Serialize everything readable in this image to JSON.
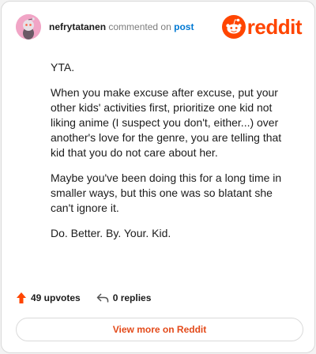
{
  "comment": {
    "username": "nefrytatanen",
    "action_text": "commented on",
    "post_link": "post",
    "paragraphs": [
      "YTA.",
      "When you make excuse after excuse, put your other kids' activities first, prioritize one kid not liking anime (I suspect you don't, either...) over another's love for the genre, you are telling that kid that you do not care about her.",
      "Maybe you've been doing this for a long time in smaller ways, but this one was so blatant she can't ignore it.",
      "Do. Better. By. Your. Kid."
    ]
  },
  "brand": {
    "logo_text": "reddit",
    "accent": "#ff4500"
  },
  "footer": {
    "upvotes": "49 upvotes",
    "replies": "0 replies",
    "view_more": "View more on Reddit",
    "upvote_icon": "upvote-arrow-icon",
    "reply_icon": "reply-arrow-icon"
  }
}
